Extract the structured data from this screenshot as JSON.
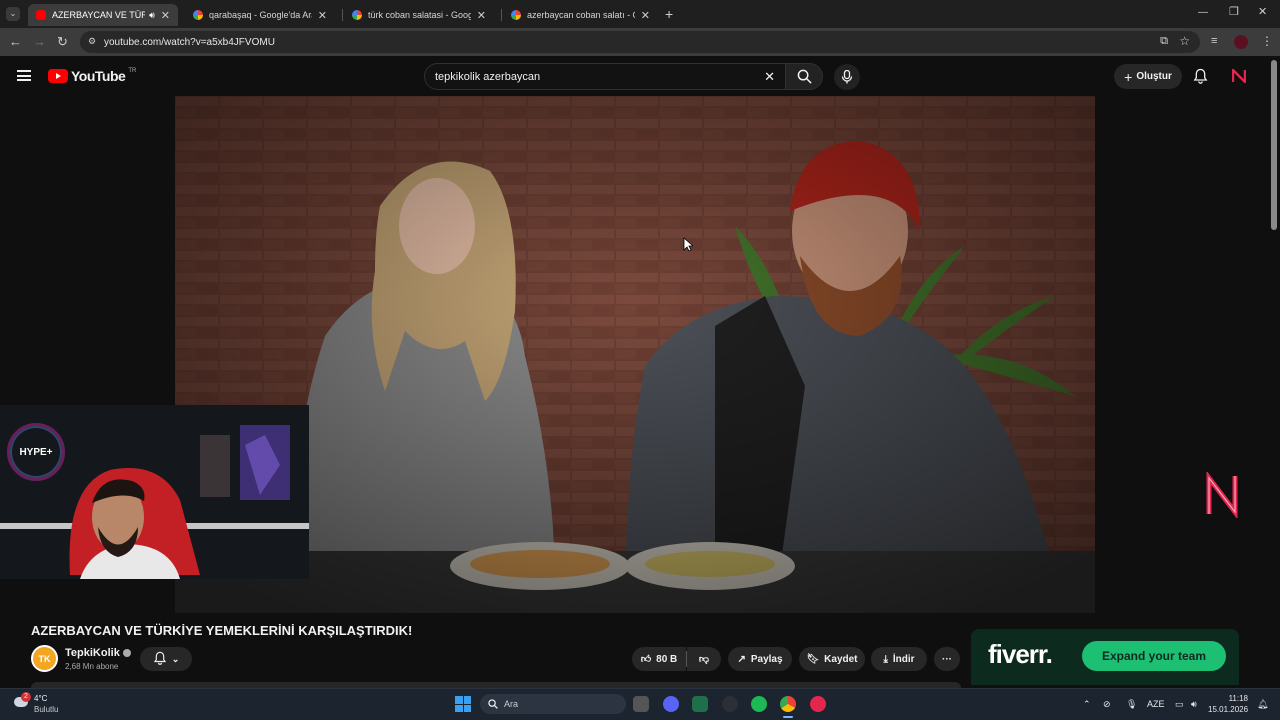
{
  "browser": {
    "tabs": [
      {
        "title": "AZERBAYCAN VE TÜRKİYE YEMEKLERİNİ",
        "icon": "youtube-icon",
        "active": true
      },
      {
        "title": "qarabaşaq - Google'da Ara",
        "icon": "google-icon",
        "active": false
      },
      {
        "title": "türk coban salatasi - Google'da",
        "icon": "google-icon",
        "active": false
      },
      {
        "title": "azerbaycan coban salatı - Goog",
        "icon": "google-icon",
        "active": false
      }
    ],
    "new_tab_label": "+",
    "url": "youtube.com/watch?v=a5xb4JFVOMU"
  },
  "youtube": {
    "logo_text": "YouTube",
    "region": "TR",
    "search_value": "tepkikolik azerbaycan",
    "create_label": "Oluştur"
  },
  "video": {
    "webcam_badge": "HYPE+",
    "title": "AZERBAYCAN VE TÜRKİYE YEMEKLERİNİ KARŞILAŞTIRDIK!",
    "channel_name": "TepkiKolik",
    "channel_initials": "TK",
    "subscribers": "2,68 Mn abone",
    "likes": "80 B",
    "share_label": "Paylaş",
    "save_label": "Kaydet",
    "download_label": "İndir",
    "more_label": "···"
  },
  "ad": {
    "brand": "fiverr.",
    "cta": "Expand your team"
  },
  "taskbar": {
    "weather_temp": "4°C",
    "weather_desc": "Bulutlu",
    "weather_badge": "2",
    "search_placeholder": "Ara",
    "language": "AZE",
    "time": "11:18",
    "date": "15.01.2026"
  },
  "colors": {
    "youtube_red": "#ff0000",
    "ad_green": "#1dbf73",
    "page_bg": "#0f0f0f"
  }
}
